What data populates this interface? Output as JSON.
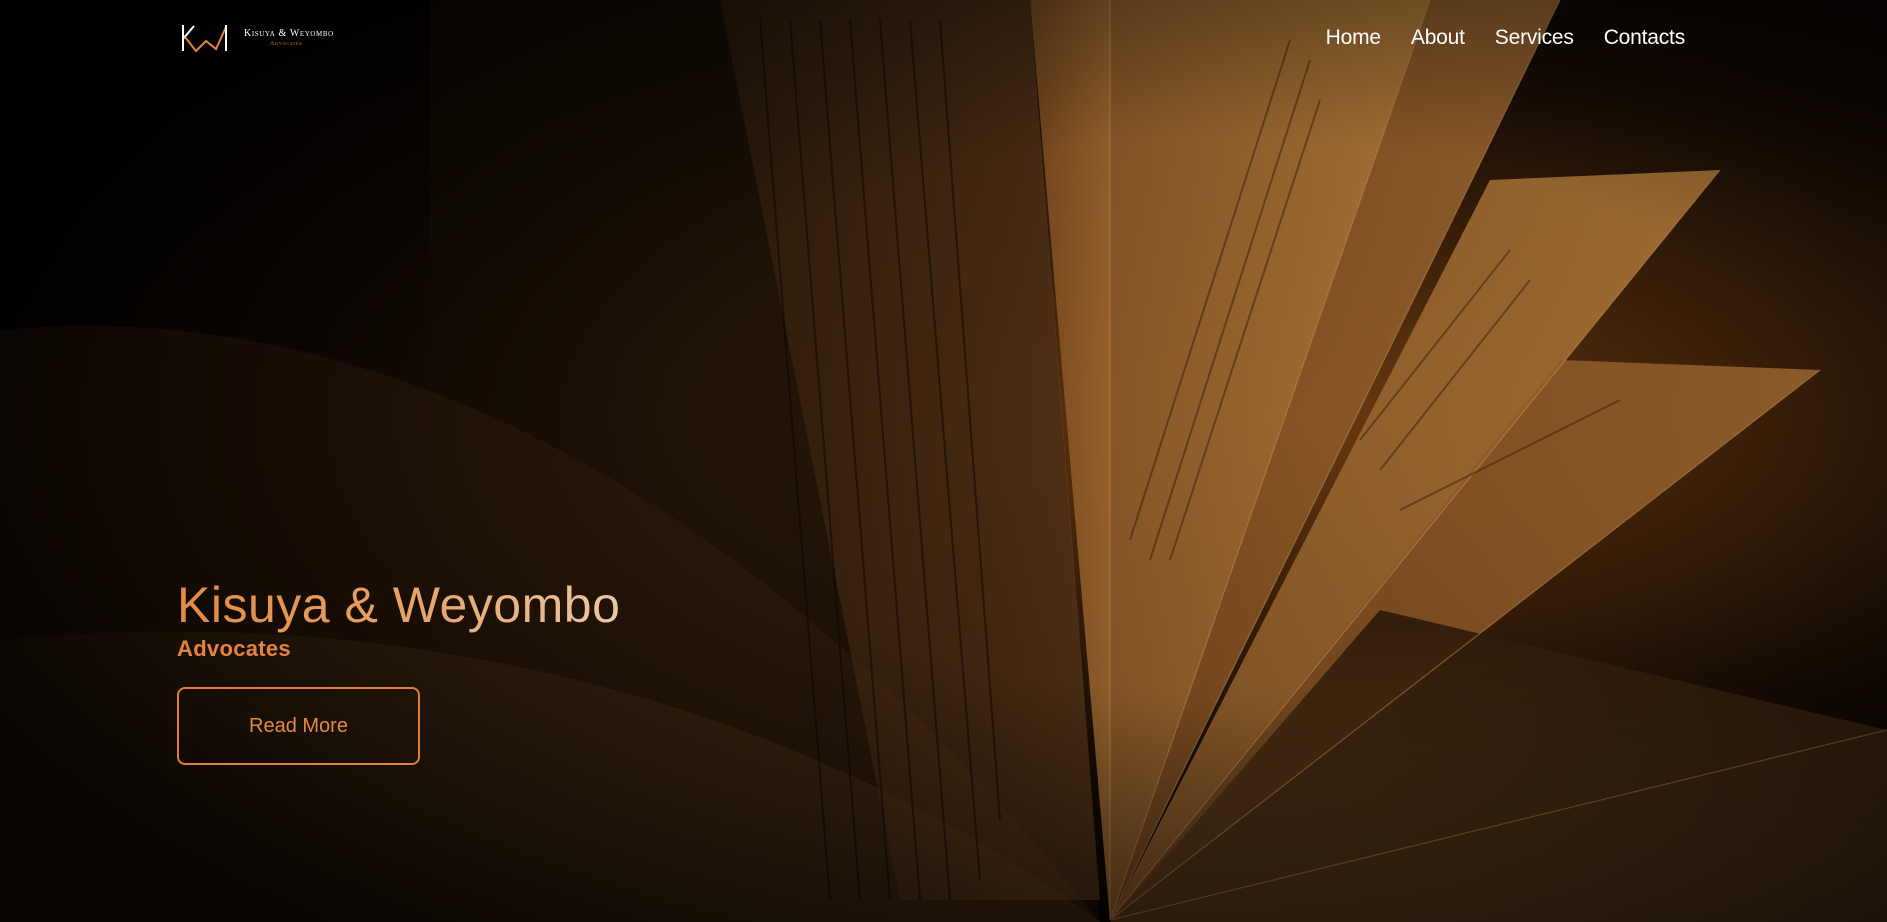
{
  "brand": {
    "logo_title": "Kisuya & Weyombo",
    "logo_subtitle": "Advocates",
    "accent_color": "#e1843f"
  },
  "nav": {
    "items": [
      {
        "label": "Home"
      },
      {
        "label": "About"
      },
      {
        "label": "Services"
      },
      {
        "label": "Contacts"
      }
    ]
  },
  "hero": {
    "title": "Kisuya & Weyombo",
    "subtitle": "Advocates",
    "cta_label": "Read More",
    "background": "open-book-photo"
  }
}
